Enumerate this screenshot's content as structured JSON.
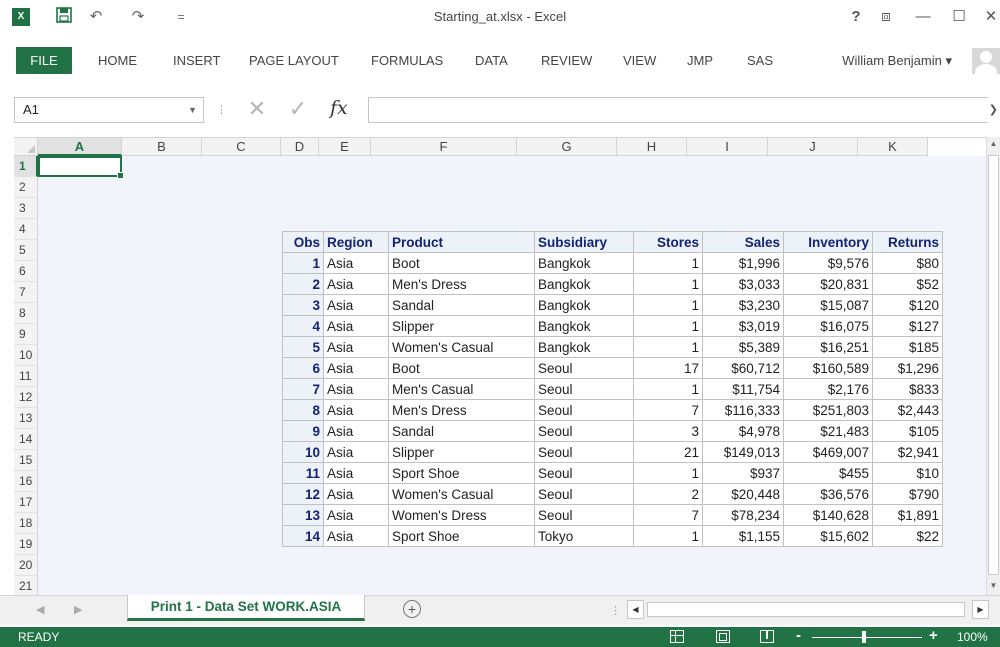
{
  "window": {
    "title": "Starting_at.xlsx - Excel",
    "logo": "X",
    "help": "?",
    "ribbon_display": "⧈",
    "minimize": "—",
    "maximize": "☐",
    "close": "✕"
  },
  "quick_access": {
    "save_icon": "save-icon",
    "undo": "↶",
    "redo": "↷",
    "customize": "="
  },
  "ribbon": {
    "tabs": [
      "FILE",
      "HOME",
      "INSERT",
      "PAGE LAYOUT",
      "FORMULAS",
      "DATA",
      "REVIEW",
      "VIEW",
      "JMP",
      "SAS"
    ],
    "user": "William Benjamin ▾"
  },
  "formula_bar": {
    "name_box": "A1",
    "name_box_arrow": "▼",
    "dots": "⋮",
    "cancel": "✕",
    "enter": "✓",
    "fx": "fx",
    "value": "",
    "expand": "❯"
  },
  "grid": {
    "columns": [
      "A",
      "B",
      "C",
      "D",
      "E",
      "F",
      "G",
      "H",
      "I",
      "J",
      "K"
    ],
    "rows": [
      "1",
      "2",
      "3",
      "4",
      "5",
      "6",
      "7",
      "8",
      "9",
      "10",
      "11",
      "12",
      "13",
      "14",
      "15",
      "16",
      "17",
      "18",
      "19",
      "20",
      "21",
      "22"
    ],
    "selected_column": "A",
    "selected_row": "1"
  },
  "table": {
    "headers": [
      "Obs",
      "Region",
      "Product",
      "Subsidiary",
      "Stores",
      "Sales",
      "Inventory",
      "Returns"
    ],
    "rows": [
      [
        "1",
        "Asia",
        "Boot",
        "Bangkok",
        "1",
        "$1,996",
        "$9,576",
        "$80"
      ],
      [
        "2",
        "Asia",
        "Men's Dress",
        "Bangkok",
        "1",
        "$3,033",
        "$20,831",
        "$52"
      ],
      [
        "3",
        "Asia",
        "Sandal",
        "Bangkok",
        "1",
        "$3,230",
        "$15,087",
        "$120"
      ],
      [
        "4",
        "Asia",
        "Slipper",
        "Bangkok",
        "1",
        "$3,019",
        "$16,075",
        "$127"
      ],
      [
        "5",
        "Asia",
        "Women's Casual",
        "Bangkok",
        "1",
        "$5,389",
        "$16,251",
        "$185"
      ],
      [
        "6",
        "Asia",
        "Boot",
        "Seoul",
        "17",
        "$60,712",
        "$160,589",
        "$1,296"
      ],
      [
        "7",
        "Asia",
        "Men's Casual",
        "Seoul",
        "1",
        "$11,754",
        "$2,176",
        "$833"
      ],
      [
        "8",
        "Asia",
        "Men's Dress",
        "Seoul",
        "7",
        "$116,333",
        "$251,803",
        "$2,443"
      ],
      [
        "9",
        "Asia",
        "Sandal",
        "Seoul",
        "3",
        "$4,978",
        "$21,483",
        "$105"
      ],
      [
        "10",
        "Asia",
        "Slipper",
        "Seoul",
        "21",
        "$149,013",
        "$469,007",
        "$2,941"
      ],
      [
        "11",
        "Asia",
        "Sport Shoe",
        "Seoul",
        "1",
        "$937",
        "$455",
        "$10"
      ],
      [
        "12",
        "Asia",
        "Women's Casual",
        "Seoul",
        "2",
        "$20,448",
        "$36,576",
        "$790"
      ],
      [
        "13",
        "Asia",
        "Women's Dress",
        "Seoul",
        "7",
        "$78,234",
        "$140,628",
        "$1,891"
      ],
      [
        "14",
        "Asia",
        "Sport Shoe",
        "Tokyo",
        "1",
        "$1,155",
        "$15,602",
        "$22"
      ]
    ]
  },
  "sheets": {
    "prev": "◀",
    "next": "▶",
    "active_tab": "Print 1 - Data Set WORK.ASIA",
    "add": "+",
    "dots": "⋮",
    "scroll_left": "◀",
    "scroll_right": "▶"
  },
  "vscroll": {
    "up": "▲",
    "down": "▼"
  },
  "status": {
    "text": "READY",
    "zoom_minus": "-",
    "zoom_plus": "+",
    "zoom": "100%"
  },
  "colors": {
    "accent": "#217346",
    "obs_text": "#112277",
    "header_bg": "#edf2f9"
  }
}
